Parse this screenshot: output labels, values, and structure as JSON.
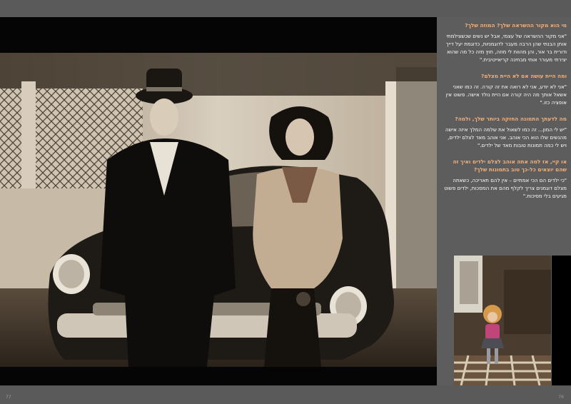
{
  "interview": [
    {
      "q": "מי הוא מקור ההשראה שלך? המוזה שלך?",
      "a": "\"אני מקור ההשראה של עצמי, אבל יש נשים שכשצילמתי אותן הבנתי שהן הרבה מעבר לדוגמניות, כדוגמת יעל דייך ודורית בר אור, והן מהוות לי מוזה, חוץ מזה כל מה שהוא יצירתי מעורר אותי מבחינה קריאייטיבית.\""
    },
    {
      "q": "ומה היית עושה אם לא היית מצלם?",
      "a": "\"אני לא יודע, אני לא רואה את זה קורה. זה כמו שאני אשאל אותך מה היה קורה אם היית נולד אישה. פשוט אין אופציה כזו.\""
    },
    {
      "q": "מה לדעתך התמונה החזקה ביותר שלך, ולמה?",
      "a": "\"יש לי המון... זה כמו לשאול את שלמה המלך איזה אישה מהנשים שלו הוא הכי אוהב. אני אוהב מאד לצלם ילדים, ויש לי כמה תמונות טובות מאד של ילדים.\""
    },
    {
      "q": "או קיי, אז למה אתה אוהב לצלם ילדים ואיך זה שהם יוצאים כל-כך טוב בתמונות שלך?",
      "a": "\"כי ילדים הם הכי אמתיים – אין להם תאריכה, כשאתה מצלם דוגמנים צריך לקלף מהם את המסכות, ילדים פשוט מגיעים בלי מסיכות.\""
    }
  ],
  "folio": {
    "left": "77",
    "right": "76"
  },
  "colors": {
    "question": "#f2b07a",
    "answer": "#ffffff",
    "panel": "#5d5d5d"
  }
}
